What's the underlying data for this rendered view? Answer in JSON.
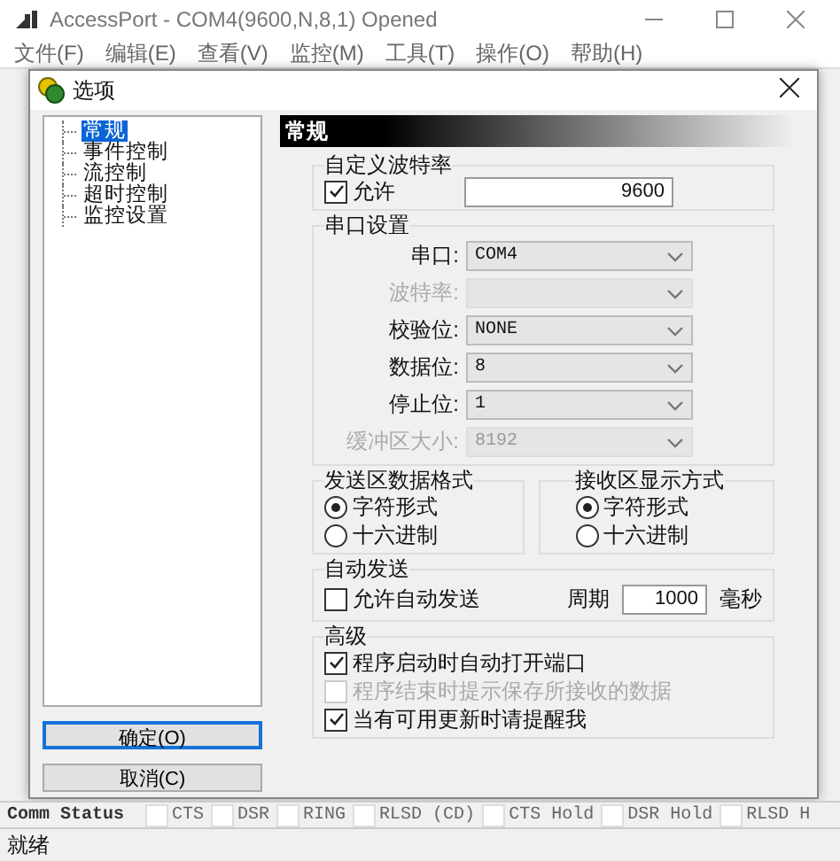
{
  "app": {
    "title": "AccessPort - COM4(9600,N,8,1) Opened"
  },
  "menu": [
    "文件(F)",
    "编辑(E)",
    "查看(V)",
    "监控(M)",
    "工具(T)",
    "操作(O)",
    "帮助(H)"
  ],
  "dialog": {
    "title": "选项",
    "tree": [
      {
        "label": "常规",
        "selected": true
      },
      {
        "label": "事件控制",
        "selected": false
      },
      {
        "label": "流控制",
        "selected": false
      },
      {
        "label": "超时控制",
        "selected": false
      },
      {
        "label": "监控设置",
        "selected": false
      }
    ],
    "buttons": [
      {
        "label": "确定(O)",
        "default": true
      },
      {
        "label": "取消(C)",
        "default": false
      }
    ],
    "header": "常规",
    "custom_baud": {
      "title": "自定义波特率",
      "allow_label": "允许",
      "checked": true,
      "value": "9600"
    },
    "serial": {
      "title": "串口设置",
      "fields": [
        {
          "label": "串口:",
          "value": "COM4",
          "disabled": false
        },
        {
          "label": "波特率:",
          "disabled": true
        },
        {
          "label": "校验位:",
          "value": "NONE",
          "disabled": false
        },
        {
          "label": "数据位:",
          "value": "8",
          "disabled": false
        },
        {
          "label": "停止位:",
          "value": "1",
          "disabled": false
        },
        {
          "label": "缓冲区大小:",
          "value": "8192",
          "disabled": true
        }
      ]
    },
    "send_format": {
      "title": "发送区数据格式",
      "options": [
        {
          "label": "字符形式",
          "selected": true
        },
        {
          "label": "十六进制",
          "selected": false
        }
      ]
    },
    "receive_format": {
      "title": "接收区显示方式",
      "options": [
        {
          "label": "字符形式",
          "selected": true
        },
        {
          "label": "十六进制",
          "selected": false
        }
      ]
    },
    "auto_send": {
      "title": "自动发送",
      "label": "允许自动发送",
      "checked": false,
      "period_label": "周期",
      "period_value": "1000",
      "unit": "毫秒"
    },
    "advanced": {
      "title": "高级",
      "options": [
        {
          "label": "程序启动时自动打开端口",
          "checked": true,
          "disabled": false
        },
        {
          "label": "程序结束时提示保存所接收的数据",
          "checked": false,
          "disabled": true
        },
        {
          "label": "当有可用更新时请提醒我",
          "checked": true,
          "disabled": false
        }
      ]
    }
  },
  "comm_status": {
    "label": "Comm Status",
    "items": [
      {
        "label": "CTS",
        "checked": false
      },
      {
        "label": "DSR",
        "checked": false
      },
      {
        "label": "RING",
        "checked": false
      },
      {
        "label": "RLSD (CD)",
        "checked": false
      },
      {
        "label": "CTS Hold",
        "checked": false
      },
      {
        "label": "DSR Hold",
        "checked": false
      },
      {
        "label": "RLSD H",
        "checked": false
      }
    ]
  },
  "status_bar": {
    "text": "就绪"
  }
}
